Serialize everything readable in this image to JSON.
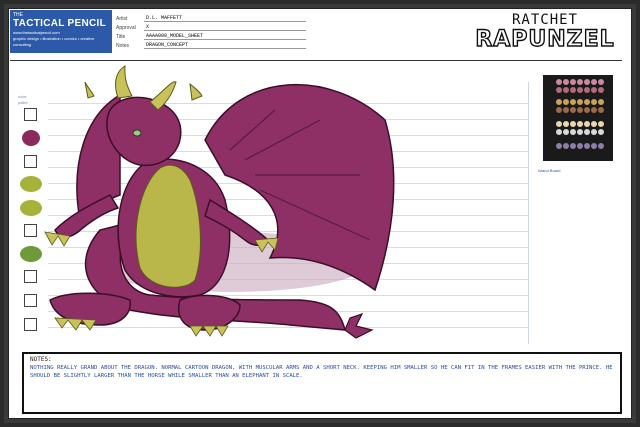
{
  "logo": {
    "top_line": "THE",
    "name": "TACTICAL PENCIL",
    "sub_line_1": "www.thetacticalpencil.com",
    "sub_line_2": "graphic design • illustration • comics • creative consulting",
    "brand_color": "#2c5aa8"
  },
  "fields": {
    "artist_label": "Artist",
    "artist_value": "D.L. MAFFETT",
    "approval_label": "Approval",
    "approval_value": "X",
    "title_label": "Title",
    "title_value": "AAAA000_MODEL_SHEET",
    "notes_label": "Notes",
    "notes_value": "DRAGON_CONCEPT"
  },
  "project": {
    "line1": "RATCHET",
    "line2": "RAPUNZEL"
  },
  "colors_column": {
    "label_1": "color",
    "label_2": "pallet"
  },
  "palette_label": "Island Board",
  "swatches": [
    "#ffffff",
    "#8b2a5b",
    "#ffffff",
    "#a6b33a",
    "#a6b33a",
    "#ffffff",
    "#6f9a3a",
    "#ffffff",
    "#ffffff",
    "#ffffff"
  ],
  "notes": {
    "heading": "NOTES:",
    "text": "NOTHING REALLY GRAND ABOUT THE DRAGON. NORMAL CARTOON DRAGON, WITH MUSCULAR ARMS AND A SHORT NECK. KEEPING HIM SMALLER SO HE CAN FIT IN THE FRAMES EASIER WITH THE PRINCE. HE SHOULD BE SLIGHTLY LARGER THAN THE HORSE WHILE SMALLER THAN AN ELEPHANT IN SCALE."
  },
  "dragon_colors": {
    "body": "#8e2f66",
    "belly": "#b9b64a",
    "horn": "#c7c25a",
    "shadow": "#c9a9bd"
  }
}
